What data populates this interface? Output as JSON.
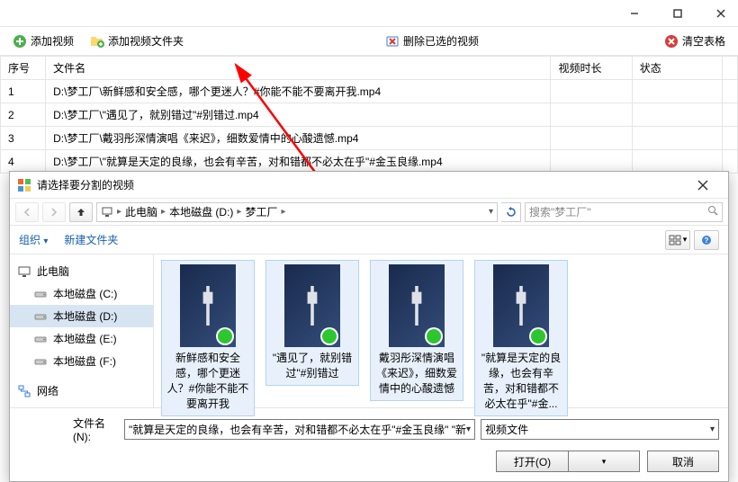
{
  "toolbar": {
    "add_video": "添加视频",
    "add_folder": "添加视频文件夹",
    "delete_selected": "删除已选的视频",
    "clear_table": "清空表格"
  },
  "columns": {
    "index": "序号",
    "filename": "文件名",
    "duration": "视频时长",
    "status": "状态"
  },
  "rows": [
    {
      "index": "1",
      "filename": "D:\\梦工厂\\新鲜感和安全感，哪个更迷人？#你能不能不要离开我.mp4"
    },
    {
      "index": "2",
      "filename": "D:\\梦工厂\\\"遇见了，就别错过\"#别错过.mp4"
    },
    {
      "index": "3",
      "filename": "D:\\梦工厂\\戴羽彤深情演唱《来迟》，细数爱情中的心酸遗憾.mp4"
    },
    {
      "index": "4",
      "filename": "D:\\梦工厂\\\"就算是天定的良缘，也会有辛苦，对和错都不必太在乎\"#金玉良缘.mp4"
    }
  ],
  "dialog": {
    "title": "请选择要分割的视频",
    "breadcrumb": [
      "此电脑",
      "本地磁盘 (D:)",
      "梦工厂"
    ],
    "search_placeholder": "搜索\"梦工厂\"",
    "organize": "组织",
    "new_folder": "新建文件夹",
    "nav": {
      "this_pc": "此电脑",
      "drive_c": "本地磁盘 (C:)",
      "drive_d": "本地磁盘 (D:)",
      "drive_e": "本地磁盘 (E:)",
      "drive_f": "本地磁盘 (F:)",
      "network": "网络"
    },
    "thumbs": [
      "新鲜感和安全感，哪个更迷人？#你能不能不要离开我",
      "\"遇见了，就别错过\"#别错过",
      "戴羽彤深情演唱《来迟》，细数爱情中的心酸遗憾",
      "\"就算是天定的良缘，也会有辛苦，对和错都不必太在乎\"#金..."
    ],
    "filename_label": "文件名(N):",
    "selected_text": "\"就算是天定的良缘，也会有辛苦，对和错都不必太在乎\"#金玉良缘\" \"新",
    "filetype_label": "视频文件",
    "open": "打开(O)",
    "cancel": "取消"
  }
}
